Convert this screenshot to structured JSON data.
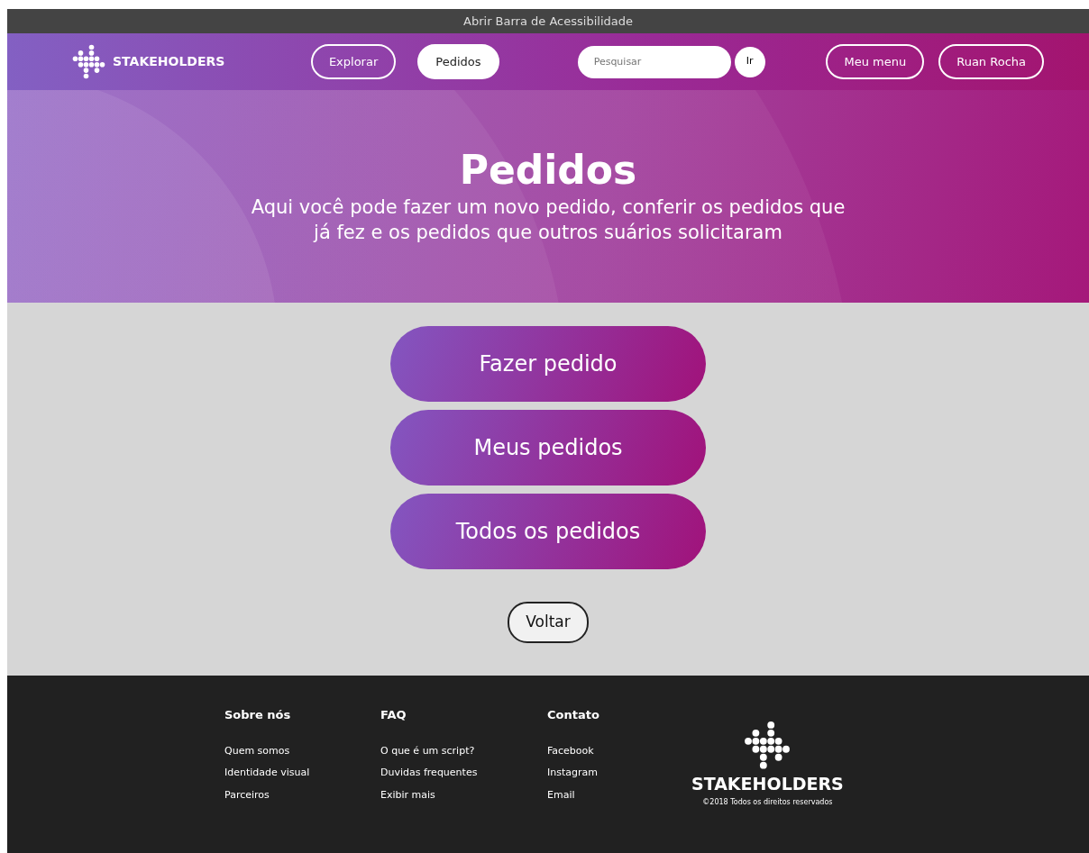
{
  "accessibility_bar": {
    "label": "Abrir Barra de Acessibilidade"
  },
  "header": {
    "brand": "STAKEHOLDERS",
    "nav": [
      {
        "label": "Explorar",
        "selected": false
      },
      {
        "label": "Pedidos",
        "selected": true
      }
    ],
    "search": {
      "placeholder": "Pesquisar",
      "button": "Ir"
    },
    "user_menu": [
      {
        "label": "Meu menu"
      },
      {
        "label": "Ruan Rocha"
      }
    ]
  },
  "hero": {
    "title": "Pedidos",
    "subtitle": "Aqui você pode fazer um novo pedido, conferir os pedidos que já fez e os pedidos que outros suários solicitaram"
  },
  "actions": [
    {
      "label": "Fazer pedido"
    },
    {
      "label": "Meus pedidos"
    },
    {
      "label": "Todos os pedidos"
    }
  ],
  "back_button": "Voltar",
  "footer": {
    "columns": [
      {
        "title": "Sobre nós",
        "links": [
          "Quem somos",
          "Identidade visual",
          "Parceiros"
        ]
      },
      {
        "title": "FAQ",
        "links": [
          "O que é um script?",
          "Duvidas frequentes",
          "Exibir mais"
        ]
      },
      {
        "title": "Contato",
        "links": [
          "Facebook",
          "Instagram",
          "Email"
        ]
      }
    ],
    "brand": "STAKEHOLDERS",
    "copyright": "©2018 Todos os direitos reservados"
  }
}
